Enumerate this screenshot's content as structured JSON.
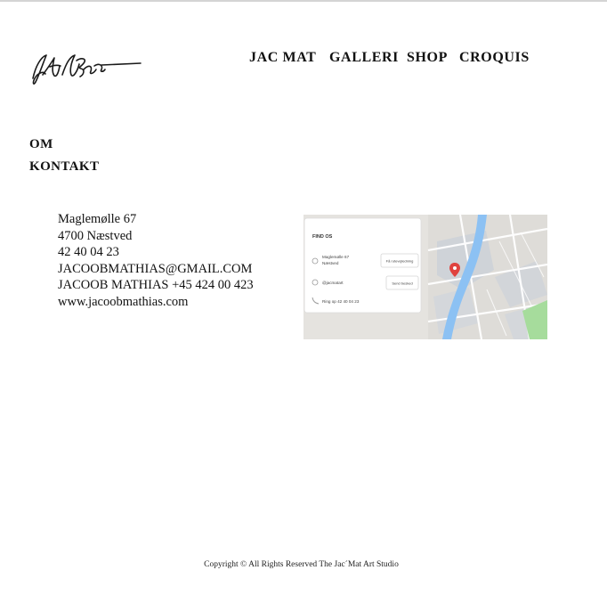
{
  "header": {
    "logo_icon": "signature-logo-icon",
    "nav": [
      "JAC MAT",
      "GALLERI",
      "SHOP",
      "CROQUIS"
    ]
  },
  "side_nav": [
    "OM",
    "KONTAKT"
  ],
  "contact": {
    "lines": [
      "Maglemølle 67",
      "4700 Næstved",
      "42 40 04 23",
      "JACOOBMATHIAS@GMAIL.COM",
      "JACOOB MATHIAS +45 424 00 423",
      "www.jacoobmathias.com"
    ]
  },
  "map": {
    "title": "FIND OS",
    "address_line1": "Maglemølle 67",
    "address_line2": "Næstved",
    "route_button": "Få rutevejledning",
    "handle": "@jacmatart",
    "message_button": "Send besked",
    "phone": "Ring op 42 40 04 23",
    "pin_color": "#e0433f",
    "river_color": "#8cc1f3",
    "park_color": "#a6dc9c"
  },
  "footer": {
    "copyright": "Copyright ©  All Rights Reserved The Jac´Mat Art Studio"
  }
}
